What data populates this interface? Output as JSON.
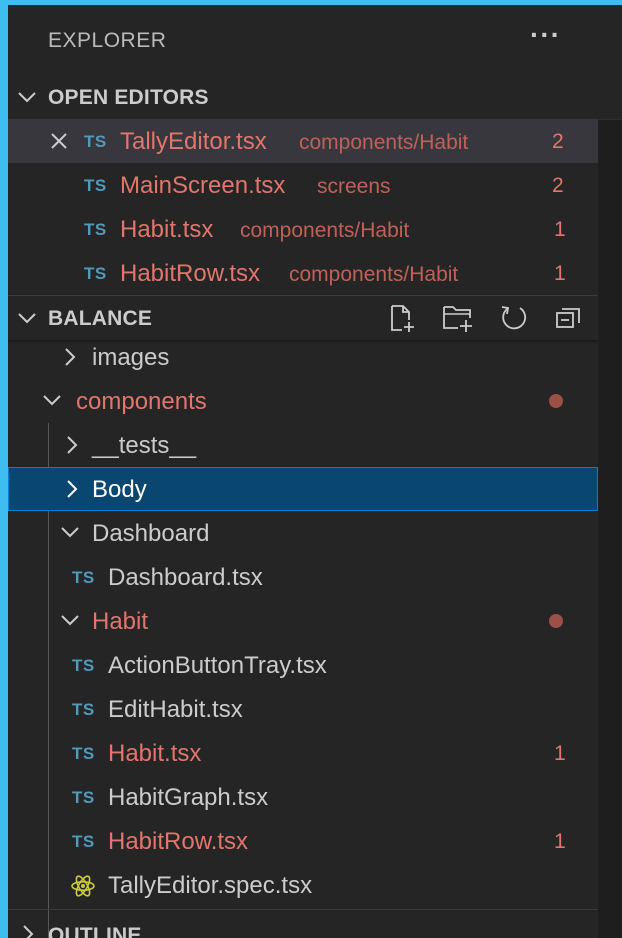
{
  "explorer": {
    "title": "EXPLORER",
    "more_actions": "···"
  },
  "open_editors": {
    "header": "OPEN EDITORS",
    "items": [
      {
        "badge_icon": "TS",
        "name": "TallyEditor.tsx",
        "path": "components/Habit",
        "count": "2"
      },
      {
        "badge_icon": "TS",
        "name": "MainScreen.tsx",
        "path": "screens",
        "count": "2"
      },
      {
        "badge_icon": "TS",
        "name": "Habit.tsx",
        "path": "components/Habit",
        "count": "1"
      },
      {
        "badge_icon": "TS",
        "name": "HabitRow.tsx",
        "path": "components/Habit",
        "count": "1"
      }
    ]
  },
  "balance": {
    "header": "BALANCE",
    "toolbar_icons": [
      "new-file-icon",
      "new-folder-icon",
      "refresh-icon",
      "collapse-all-icon"
    ],
    "tree": {
      "images": "images",
      "components": "components",
      "tests": "__tests__",
      "body": "Body",
      "dashboard": "Dashboard",
      "dashboard_file": "Dashboard.tsx",
      "habit": "Habit",
      "action_button_tray": "ActionButtonTray.tsx",
      "edit_habit": "EditHabit.tsx",
      "habit_file": "Habit.tsx",
      "habit_file_count": "1",
      "habit_graph": "HabitGraph.tsx",
      "habit_row": "HabitRow.tsx",
      "habit_row_count": "1",
      "tally_spec": "TallyEditor.spec.tsx"
    },
    "ts_badge": "TS"
  },
  "outline": {
    "header": "OUTLINE"
  },
  "colors": {
    "modified": "#e2756c",
    "ts_icon": "#519aba",
    "selection": "#094771",
    "focus_border": "#007fd4",
    "react_icon": "#cbcb41"
  }
}
